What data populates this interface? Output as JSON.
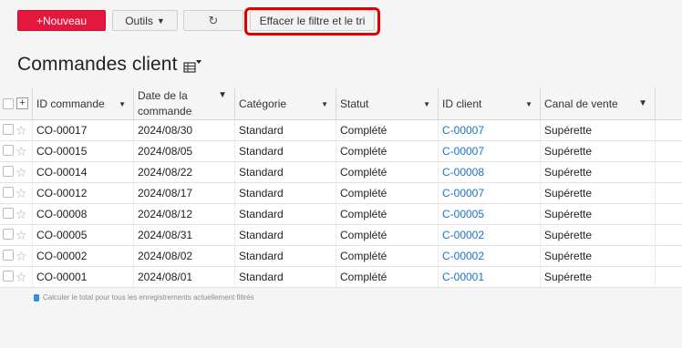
{
  "toolbar": {
    "new_label": "+Nouveau",
    "tools_label": "Outils",
    "refresh_glyph": "↻",
    "clear_filter_label": "Effacer le filtre et le tri"
  },
  "page": {
    "title": "Commandes client"
  },
  "columns": [
    {
      "label": "ID commande",
      "icon": "chevron-down-icon"
    },
    {
      "label": "Date de la commande",
      "icon": "filter-icon"
    },
    {
      "label": "Catégorie",
      "icon": "chevron-down-icon"
    },
    {
      "label": "Statut",
      "icon": "chevron-down-icon"
    },
    {
      "label": "ID client",
      "icon": "chevron-down-icon"
    },
    {
      "label": "Canal de vente",
      "icon": "filter-icon"
    }
  ],
  "rows": [
    {
      "id": "CO-00017",
      "date": "2024/08/30",
      "category": "Standard",
      "status": "Complété",
      "client": "C-00007",
      "channel": "Supérette"
    },
    {
      "id": "CO-00015",
      "date": "2024/08/05",
      "category": "Standard",
      "status": "Complété",
      "client": "C-00007",
      "channel": "Supérette"
    },
    {
      "id": "CO-00014",
      "date": "2024/08/22",
      "category": "Standard",
      "status": "Complété",
      "client": "C-00008",
      "channel": "Supérette"
    },
    {
      "id": "CO-00012",
      "date": "2024/08/17",
      "category": "Standard",
      "status": "Complété",
      "client": "C-00007",
      "channel": "Supérette"
    },
    {
      "id": "CO-00008",
      "date": "2024/08/12",
      "category": "Standard",
      "status": "Complété",
      "client": "C-00005",
      "channel": "Supérette"
    },
    {
      "id": "CO-00005",
      "date": "2024/08/31",
      "category": "Standard",
      "status": "Complété",
      "client": "C-00002",
      "channel": "Supérette"
    },
    {
      "id": "CO-00002",
      "date": "2024/08/02",
      "category": "Standard",
      "status": "Complété",
      "client": "C-00002",
      "channel": "Supérette"
    },
    {
      "id": "CO-00001",
      "date": "2024/08/01",
      "category": "Standard",
      "status": "Complété",
      "client": "C-00001",
      "channel": "Supérette"
    }
  ],
  "footer": {
    "calc_total_label": "Calculer le total pour tous les enregistrements actuellement filtrés"
  },
  "colors": {
    "accent": "#e5173f",
    "link": "#1a73c8",
    "highlight": "#e00000"
  }
}
